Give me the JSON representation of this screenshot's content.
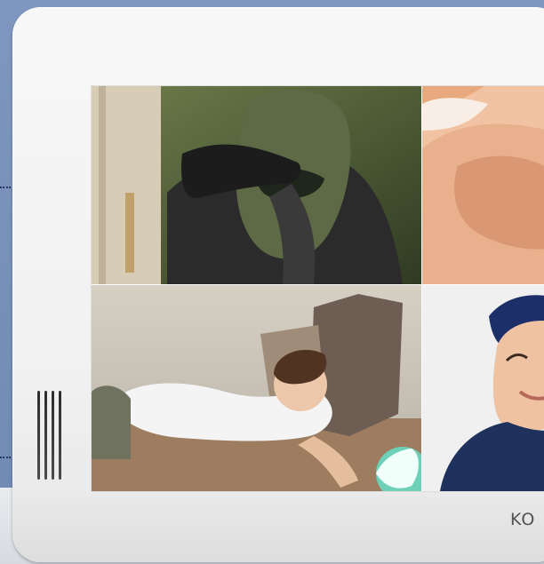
{
  "device": {
    "brand": "KO",
    "tiles": [
      {
        "scene": "masked-intruder-at-door"
      },
      {
        "scene": "baby-sleeping"
      },
      {
        "scene": "child-on-deck"
      },
      {
        "scene": "delivery-person-in-cap"
      }
    ]
  },
  "colors": {
    "background": "#7b93bb",
    "device_body": "#f3f3f3",
    "speaker": "#333333"
  }
}
